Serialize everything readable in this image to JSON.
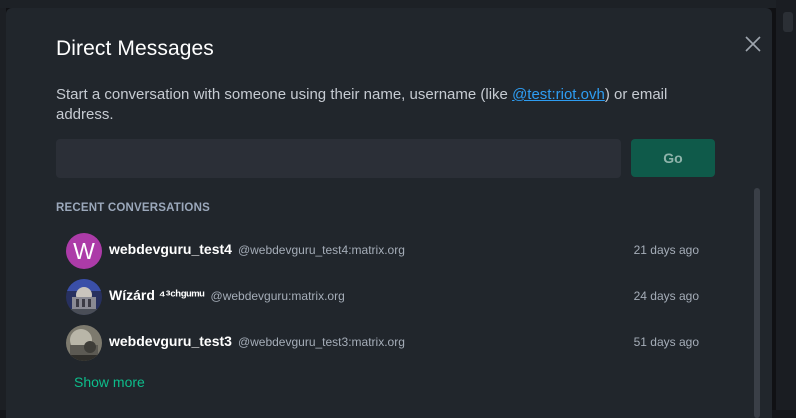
{
  "dialog": {
    "title": "Direct Messages",
    "description_prefix": "Start a conversation with someone using their name, username (like ",
    "description_link": "@test:riot.ovh",
    "description_suffix": ") or email address.",
    "input": {
      "value": "",
      "placeholder": ""
    },
    "go_label": "Go",
    "section_title": "RECENT CONVERSATIONS",
    "show_more_label": "Show more"
  },
  "conversations": [
    {
      "avatar_letter": "W",
      "name": "webdevguru_test4",
      "user_id": "@webdevguru_test4:matrix.org",
      "when": "21 days ago"
    },
    {
      "avatar_letter": "",
      "name": "Wízárd ⁴³ᶜʰᵍᵘᵐᵘ",
      "user_id": "@webdevguru:matrix.org",
      "when": "24 days ago"
    },
    {
      "avatar_letter": "",
      "name": "webdevguru_test3",
      "user_id": "@webdevguru_test3:matrix.org",
      "when": "51 days ago"
    }
  ],
  "colors": {
    "accent": "#0dbd8b",
    "go_button": "#0f5a4a",
    "link": "#2e9df2",
    "avatar_w": "#ac3ba8"
  },
  "icons": {
    "close": "close-icon"
  }
}
